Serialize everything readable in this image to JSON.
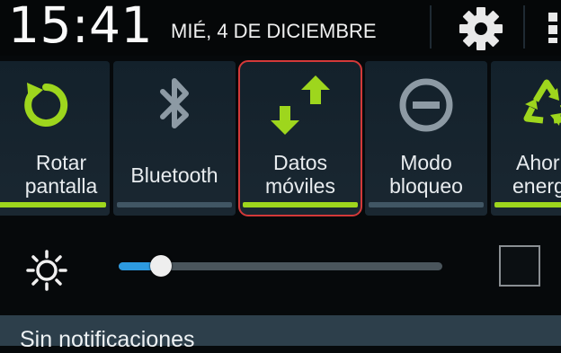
{
  "status": {
    "time": "15:41",
    "date": "MIÉ, 4 DE DICIEMBRE",
    "settings_icon": "gear-icon",
    "grid_icon": "grid-icon"
  },
  "toggles": [
    {
      "label_line1": "Rotar",
      "label_line2": "pantalla",
      "state": "on",
      "icon": "rotate-icon"
    },
    {
      "label_line1": "Bluetooth",
      "label_line2": "",
      "state": "off",
      "icon": "bluetooth-icon"
    },
    {
      "label_line1": "Datos",
      "label_line2": "móviles",
      "state": "on",
      "icon": "mobile-data-arrows-icon"
    },
    {
      "label_line1": "Modo",
      "label_line2": "bloqueo",
      "state": "off",
      "icon": "block-mode-icon"
    },
    {
      "label_line1": "Ahor",
      "label_line2": "energ",
      "state": "on",
      "icon": "recycle-power-saving-icon"
    }
  ],
  "brightness": {
    "level": 0.13,
    "sun_icon": "sun-icon",
    "auto_checked": false
  },
  "notifications": {
    "empty_label": "Sin notificaciones"
  },
  "colors": {
    "accent_green": "#9ed61d",
    "off_bar": "#415664",
    "highlight": "#d33939",
    "slider_blue": "#2d9ae0"
  }
}
